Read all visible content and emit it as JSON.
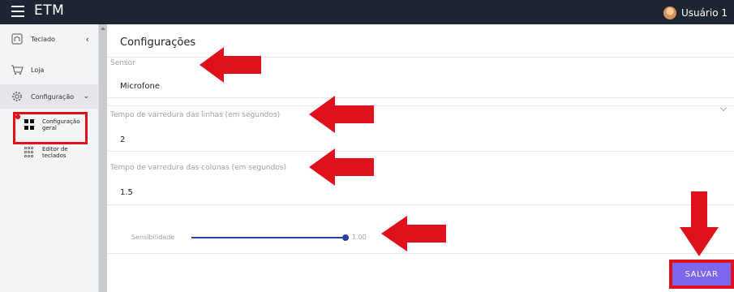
{
  "app": {
    "title": "ETM",
    "user_name": "Usuário 1"
  },
  "sidebar": {
    "items": [
      {
        "label": "Teclado",
        "icon": "keyboard-icon"
      },
      {
        "label": "Loja",
        "icon": "cart-icon"
      },
      {
        "label": "Configuração",
        "icon": "gear-icon"
      }
    ],
    "subitems": [
      {
        "label_line1": "Configuração",
        "label_line2": "geral",
        "icon": "grid-icon"
      },
      {
        "label_line1": "Editor de",
        "label_line2": "teclados",
        "icon": "dots-grid-icon"
      }
    ]
  },
  "main": {
    "title": "Configurações",
    "sensor_label": "Sensor",
    "sensor_value": "Microfone",
    "row_label": "Tempo de varredura das linhas (em segundos)",
    "row_value": "2",
    "col_label": "Tempo de varredura das colunas (em segundos)",
    "col_value": "1.5",
    "sensitivity_label": "Sensibilidade",
    "sensitivity_value": "1.00",
    "save_label": "SALVAR"
  },
  "colors": {
    "topbar": "#1f2633",
    "accent": "#7b68ee",
    "annotation": "#e0101c",
    "slider": "#2f3f9e"
  }
}
